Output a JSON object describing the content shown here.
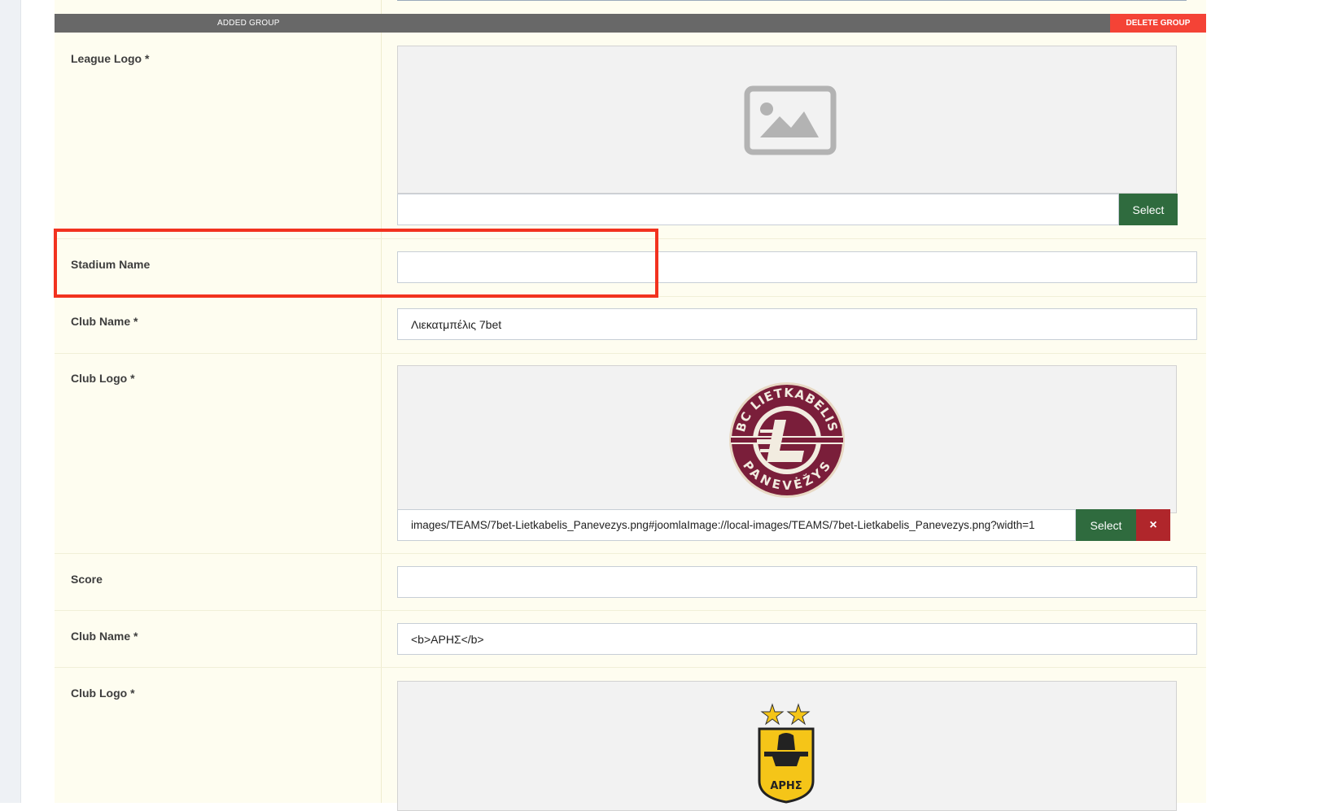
{
  "group": {
    "title": "ADDED GROUP",
    "delete_label": "DELETE GROUP"
  },
  "fields": {
    "league_logo": {
      "label": "League Logo *",
      "path_value": "",
      "select_label": "Select"
    },
    "stadium_name": {
      "label": "Stadium Name",
      "value": ""
    },
    "club_name_1": {
      "label": "Club Name *",
      "value": "Λιεκατμπέλις 7bet"
    },
    "club_logo_1": {
      "label": "Club Logo *",
      "path_value": "images/TEAMS/7bet-Lietkabelis_Panevezys.png#joomlaImage://local-images/TEAMS/7bet-Lietkabelis_Panevezys.png?width=1",
      "select_label": "Select",
      "clear_label": "×",
      "logo_text_top": "BC LIETKABELIS",
      "logo_text_bottom": "PANEVĖŽYS"
    },
    "score": {
      "label": "Score",
      "value": ""
    },
    "club_name_2": {
      "label": "Club Name *",
      "value": "<b>ΑΡΗΣ</b>"
    },
    "club_logo_2": {
      "label": "Club Logo *",
      "logo_text": "ΑΡΗΣ"
    }
  },
  "colors": {
    "select": "#2f6b3e",
    "clear": "#b0262b",
    "delete": "#f44336",
    "highlight": "#f2321f"
  }
}
